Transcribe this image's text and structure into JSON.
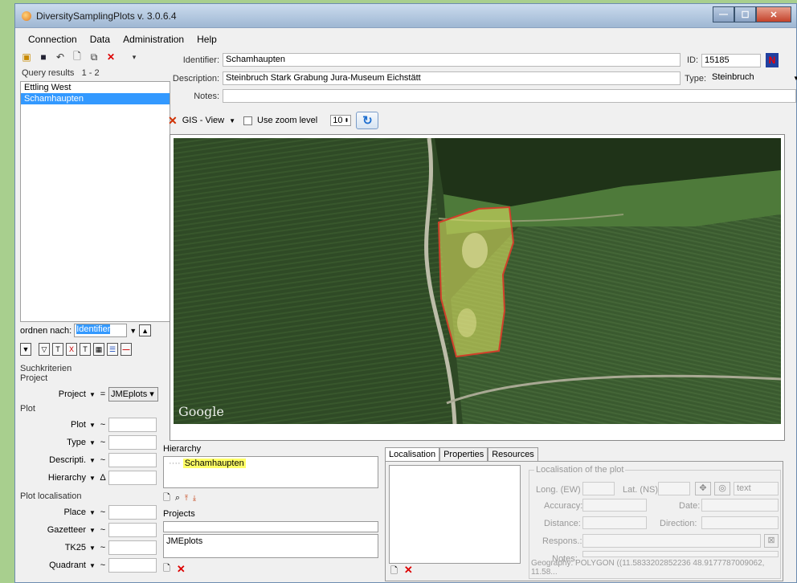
{
  "window": {
    "title": "DiversitySamplingPlots   v. 3.0.6.4"
  },
  "menu": [
    "Connection",
    "Data",
    "Administration",
    "Help"
  ],
  "query": {
    "label": "Query results",
    "range": "1 - 2",
    "items": [
      "Ettling West",
      "Schamhaupten"
    ],
    "selected": 1
  },
  "sort": {
    "label": "ordnen nach:",
    "value": "Identifier"
  },
  "search": {
    "title": "Suchkriterien",
    "project_group": "Project",
    "project_label": "Project",
    "project_op": "=",
    "project_value": "JMEplots",
    "plot_group": "Plot",
    "plot_rows": [
      {
        "label": "Plot",
        "op": "~"
      },
      {
        "label": "Type",
        "op": "~"
      },
      {
        "label": "Descripti.",
        "op": "~"
      },
      {
        "label": "Hierarchy",
        "op": "Δ"
      }
    ],
    "loc_group": "Plot localisation",
    "loc_rows": [
      {
        "label": "Place",
        "op": "~"
      },
      {
        "label": "Gazetteer",
        "op": "~"
      },
      {
        "label": "TK25",
        "op": "~"
      },
      {
        "label": "Quadrant",
        "op": "~"
      }
    ]
  },
  "detail": {
    "identifier_label": "Identifier:",
    "identifier": "Schamhaupten",
    "id_label": "ID:",
    "id": "15185",
    "description_label": "Description:",
    "description": "Steinbruch Stark Grabung Jura-Museum Eichstätt",
    "type_label": "Type:",
    "type": "Steinbruch",
    "notes_label": "Notes:",
    "notes": ""
  },
  "gis": {
    "view_label": "GIS - View",
    "zoom_label": "Use zoom level",
    "zoom_value": "10",
    "map_brand": "Google"
  },
  "hierarchy": {
    "label": "Hierarchy",
    "item": "Schamhaupten"
  },
  "projects": {
    "label": "Projects",
    "item": "JMEplots"
  },
  "tabs": [
    "Localisation",
    "Properties",
    "Resources"
  ],
  "localisation": {
    "group": "Localisation of the plot",
    "long_label": "Long. (EW)",
    "lat_label": "Lat. (NS)",
    "format": "text",
    "accuracy_label": "Accuracy:",
    "date_label": "Date:",
    "distance_label": "Distance:",
    "direction_label": "Direction:",
    "respons_label": "Respons.:",
    "notes_label": "Notes:",
    "geography": "Geography: POLYGON ((11.5833202852236 48.9177787009062, 11.58..."
  },
  "colors": {
    "selection": "#3399ff",
    "highlight": "#ffff66",
    "polygon_stroke": "#d0402a"
  }
}
